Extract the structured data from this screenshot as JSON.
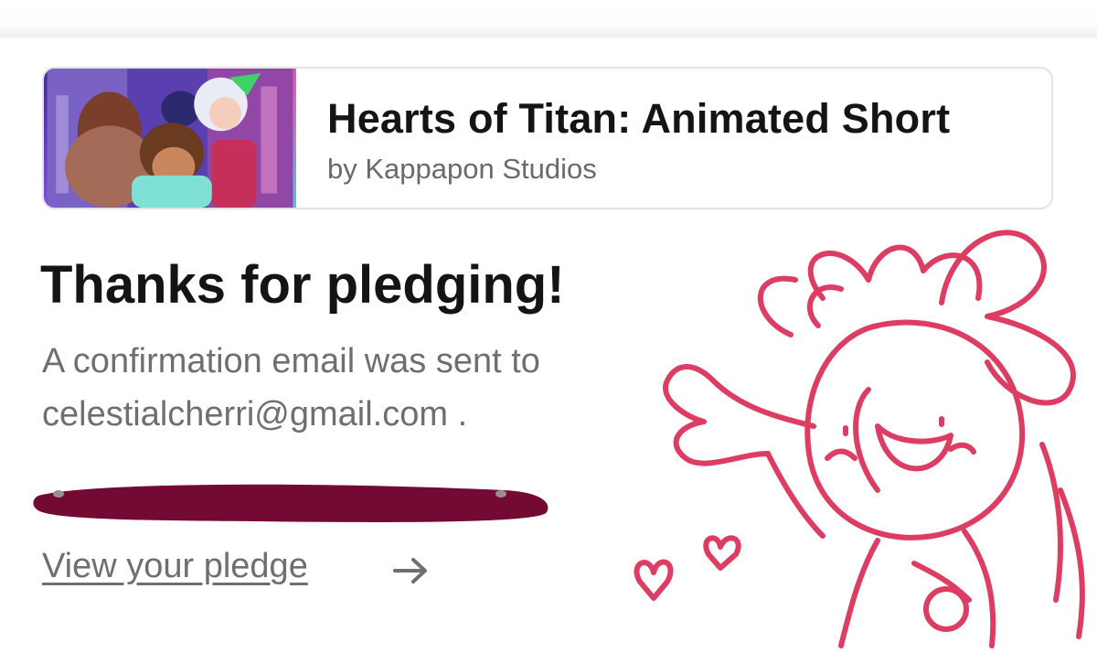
{
  "project": {
    "title": "Hearts of Titan: Animated Short",
    "creator": "by Kappapon Studios"
  },
  "confirmation": {
    "heading": "Thanks for pledging!",
    "message": "A confirmation email was sent to",
    "email": "celestialcherri@gmail.com ."
  },
  "actions": {
    "view_pledge_label": "View your pledge",
    "arrow_icon": "arrow-right-icon"
  },
  "colors": {
    "heading": "#141414",
    "muted_text": "#6f6f6f",
    "redaction": "#730a33",
    "doodle": "#dd3d63"
  }
}
